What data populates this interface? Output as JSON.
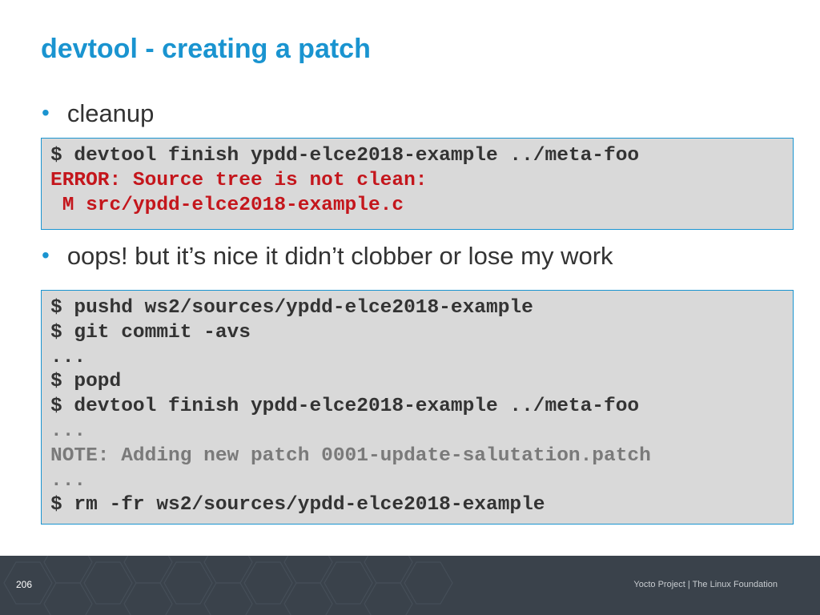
{
  "slide": {
    "title": "devtool - creating a patch",
    "page_number": "206",
    "footer": "Yocto Project | The Linux Foundation"
  },
  "bullets": [
    "cleanup",
    "oops! but it’s nice it didn’t clobber or lose my work"
  ],
  "code_blocks": [
    {
      "lines": [
        {
          "text": "$ devtool finish ypdd-elce2018-example ../meta-foo"
        },
        {
          "text": "ERROR: Source tree is not clean:"
        },
        {
          "text": " M src/ypdd-elce2018-example.c"
        }
      ]
    },
    {
      "lines": [
        {
          "text": "$ pushd ws2/sources/ypdd-elce2018-example"
        },
        {
          "text": "$ git commit -avs"
        },
        {
          "text": "..."
        },
        {
          "text": "$ popd"
        },
        {
          "text": "$ devtool finish ypdd-elce2018-example ../meta-foo"
        },
        {
          "text": "..."
        },
        {
          "text": "NOTE: Adding new patch 0001-update-salutation.patch"
        },
        {
          "text": "..."
        },
        {
          "text": "$ rm -fr ws2/sources/ypdd-elce2018-example"
        }
      ]
    }
  ],
  "colors": {
    "title": "#1a94d0",
    "bullet_dot": "#1a94d0",
    "code_background": "#d9d9d9",
    "code_border": "#1a94d0",
    "error_text": "#c4161c",
    "note_text": "#7a7a7a",
    "footer_background": "#3a424b"
  }
}
